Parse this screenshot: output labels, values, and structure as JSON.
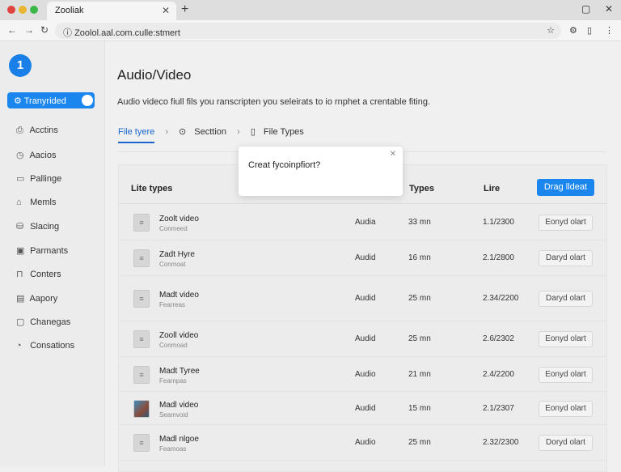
{
  "browser": {
    "tab_title": "Zooliak",
    "url": "Zoolol.aal.com.culle:stmert"
  },
  "sidebar": {
    "logo": "1",
    "active": "Tranyrided",
    "items": [
      {
        "label": "Acctins",
        "icon": "⎙"
      },
      {
        "label": "Aacios",
        "icon": "◷"
      },
      {
        "label": "Pallinge",
        "icon": "▭"
      },
      {
        "label": "Memls",
        "icon": "⌂"
      },
      {
        "label": "Slacing",
        "icon": "⛁"
      },
      {
        "label": "Parmants",
        "icon": "▣"
      },
      {
        "label": "Conters",
        "icon": "⊓"
      },
      {
        "label": "Aapory",
        "icon": "▤"
      },
      {
        "label": "Chanegas",
        "icon": "▢"
      },
      {
        "label": "Consations",
        "icon": "◔"
      }
    ]
  },
  "main": {
    "title": "Audio/Video",
    "description": "Audio videco fiull fils you ranscripten you seleirats to io rnphet a crentable fiting.",
    "crumbs": [
      "File tyere",
      "Secttion",
      "File Types"
    ],
    "table": {
      "headers": [
        "Lite types",
        "Types",
        "Lire"
      ],
      "primary_button": "Drag lldeat",
      "rows": [
        {
          "name": "Zoolt video",
          "sub": "Conmeed",
          "type": "Audia",
          "dur": "33 mn",
          "date": "1.1/2300",
          "action": "Eonyd olart"
        },
        {
          "name": "Zadt Hyre",
          "sub": "Conmoat",
          "type": "Audid",
          "dur": "16 mn",
          "date": "2.1/2800",
          "action": "Daryd olart"
        },
        {
          "name": "Madt video",
          "sub": "Fearreas",
          "type": "Audid",
          "dur": "25 mn",
          "date": "2.34/2200",
          "action": "Daryd olart"
        },
        {
          "name": "Zooll video",
          "sub": "Conmoad",
          "type": "Audid",
          "dur": "25 mn",
          "date": "2.6/2302",
          "action": "Eonyd olart"
        },
        {
          "name": "Madt Tyree",
          "sub": "Fearnpas",
          "type": "Audio",
          "dur": "21 mn",
          "date": "2.4/2200",
          "action": "Eonyd olart"
        },
        {
          "name": "Madl video",
          "sub": "Seamvoid",
          "type": "Audid",
          "dur": "15 mn",
          "date": "2.1/2307",
          "action": "Eonyd olart"
        },
        {
          "name": "Madl nlgoe",
          "sub": "Feamoas",
          "type": "Audio",
          "dur": "25 mn",
          "date": "2.32/2300",
          "action": "Doryd olart"
        }
      ]
    }
  },
  "modal": {
    "text": "Creat fycoinpfiort?"
  }
}
